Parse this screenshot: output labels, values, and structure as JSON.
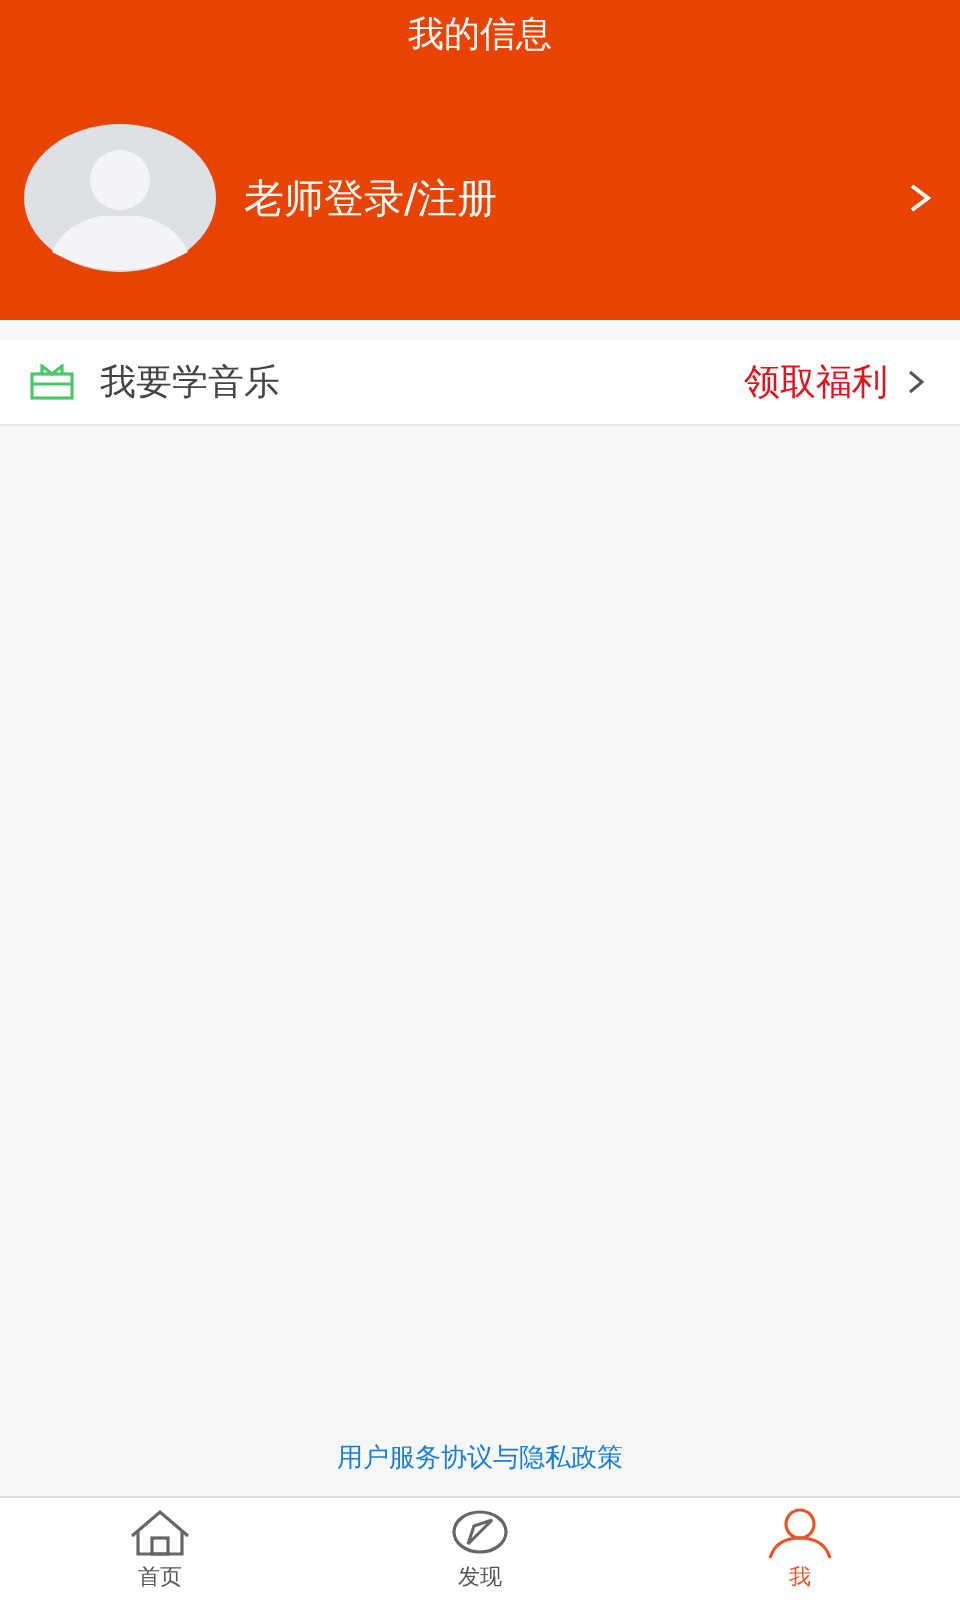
{
  "header": {
    "title": "我的信息",
    "login_label": "老师登录/注册"
  },
  "menu_row": {
    "label": "我要学音乐",
    "action": "领取福利"
  },
  "footer_link": "用户服务协议与隐私政策",
  "tabs": [
    {
      "kind": "home",
      "label": "首页",
      "selected": false
    },
    {
      "kind": "discover",
      "label": "发现",
      "selected": false
    },
    {
      "kind": "me",
      "label": "我",
      "selected": true
    }
  ]
}
